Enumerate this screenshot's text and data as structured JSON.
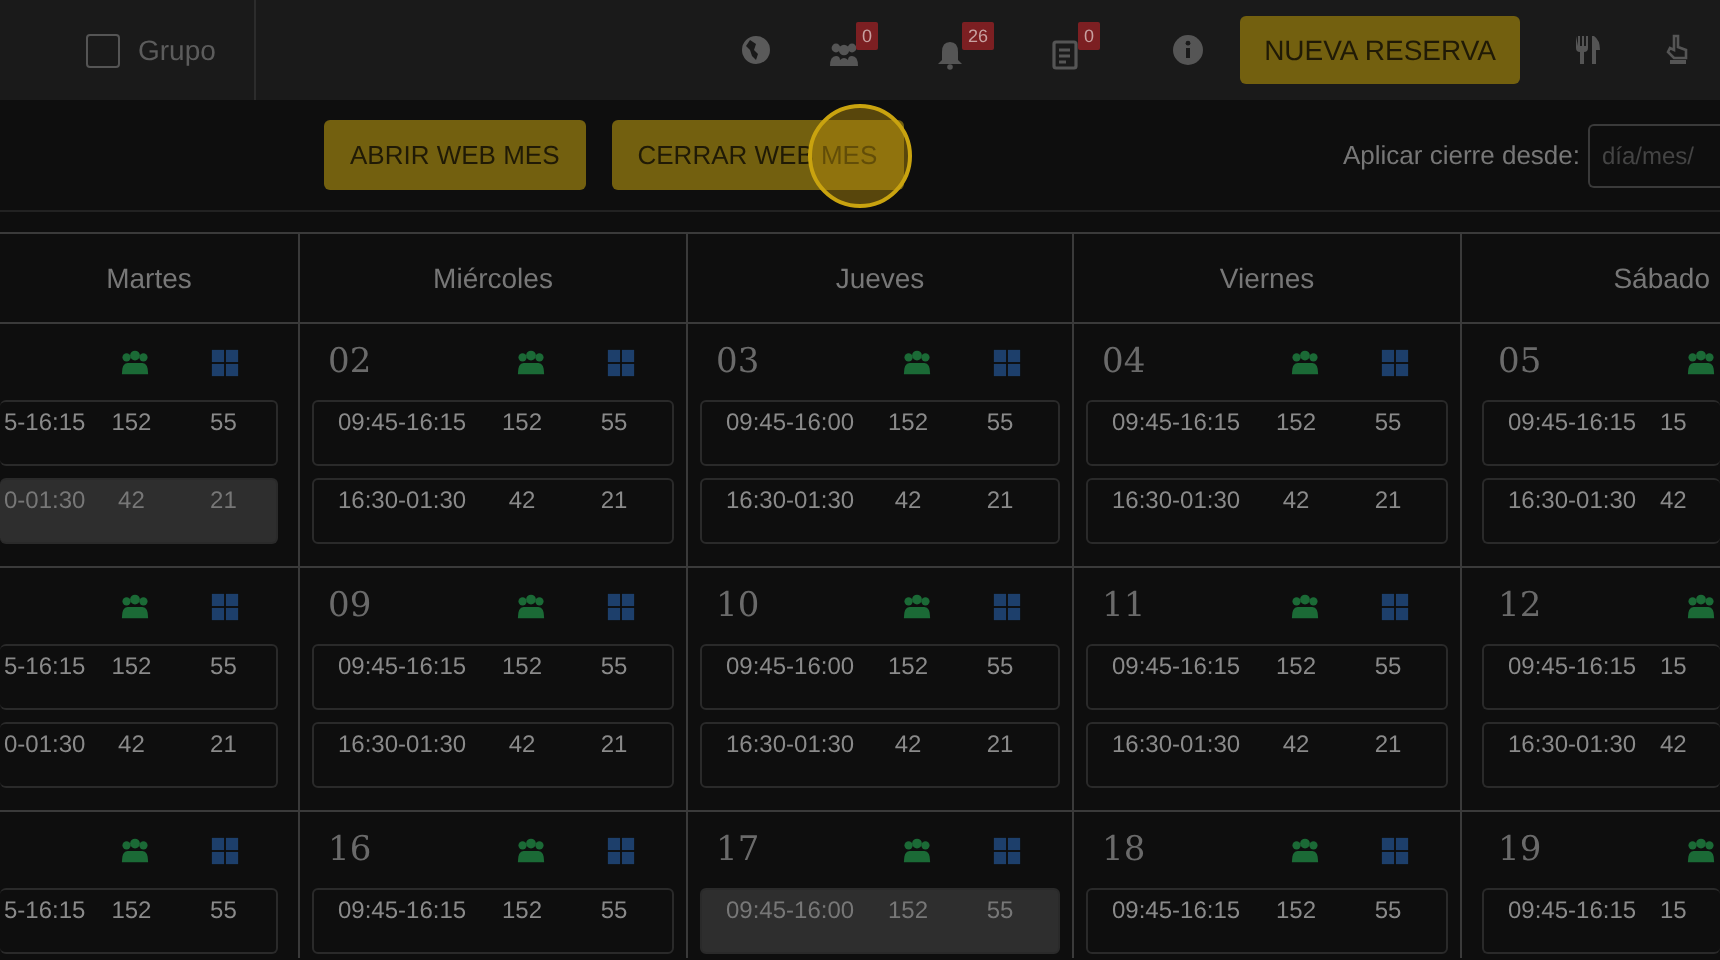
{
  "topbar": {
    "group_checkbox": {
      "label": "Grupo",
      "checked": false
    },
    "badges": [
      {
        "kind": "people",
        "count": "0"
      },
      {
        "kind": "bell",
        "count": "26"
      },
      {
        "kind": "clipboard",
        "count": "0"
      }
    ],
    "new_button": "NUEVA RESERVA"
  },
  "toolbar": {
    "buttons": [
      "ABRIR WEB MES",
      "CERRAR WEB MES"
    ],
    "close_label": "Aplicar cierre desde:",
    "date_field": {
      "placeholder": "día/mes/"
    }
  },
  "calendar": {
    "days": [
      "Martes",
      "Miércoles",
      "Jueves",
      "Viernes",
      "Sábado"
    ],
    "weeks": [
      {
        "cells": [
          {
            "slots": [
              {
                "time": "5-16:15",
                "counts": [
                  "152",
                  "55"
                ],
                "selected": false
              },
              {
                "time": "0-01:30",
                "counts": [
                  "42",
                  "21"
                ],
                "selected": true
              }
            ]
          },
          {
            "date": "02",
            "slots": [
              {
                "time": "09:45-16:15",
                "counts": [
                  "152",
                  "55"
                ],
                "selected": false
              },
              {
                "time": "16:30-01:30",
                "counts": [
                  "42",
                  "21"
                ],
                "selected": false
              }
            ]
          },
          {
            "date": "03",
            "slots": [
              {
                "time": "09:45-16:00",
                "counts": [
                  "152",
                  "55"
                ],
                "selected": false
              },
              {
                "time": "16:30-01:30",
                "counts": [
                  "42",
                  "21"
                ],
                "selected": false
              }
            ]
          },
          {
            "date": "04",
            "slots": [
              {
                "time": "09:45-16:15",
                "counts": [
                  "152",
                  "55"
                ],
                "selected": false
              },
              {
                "time": "16:30-01:30",
                "counts": [
                  "42",
                  "21"
                ],
                "selected": false
              }
            ]
          },
          {
            "date": "05",
            "slots": [
              {
                "time": "09:45-16:15",
                "counts": [
                  "15"
                ],
                "selected": false
              },
              {
                "time": "16:30-01:30",
                "counts": [
                  "42"
                ],
                "selected": false
              }
            ]
          }
        ]
      },
      {
        "cells": [
          {
            "slots": [
              {
                "time": "5-16:15",
                "counts": [
                  "152",
                  "55"
                ],
                "selected": false
              },
              {
                "time": "0-01:30",
                "counts": [
                  "42",
                  "21"
                ],
                "selected": false
              }
            ]
          },
          {
            "date": "09",
            "slots": [
              {
                "time": "09:45-16:15",
                "counts": [
                  "152",
                  "55"
                ],
                "selected": false
              },
              {
                "time": "16:30-01:30",
                "counts": [
                  "42",
                  "21"
                ],
                "selected": false
              }
            ]
          },
          {
            "date": "10",
            "slots": [
              {
                "time": "09:45-16:00",
                "counts": [
                  "152",
                  "55"
                ],
                "selected": false
              },
              {
                "time": "16:30-01:30",
                "counts": [
                  "42",
                  "21"
                ],
                "selected": false
              }
            ]
          },
          {
            "date": "11",
            "slots": [
              {
                "time": "09:45-16:15",
                "counts": [
                  "152",
                  "55"
                ],
                "selected": false
              },
              {
                "time": "16:30-01:30",
                "counts": [
                  "42",
                  "21"
                ],
                "selected": false
              }
            ]
          },
          {
            "date": "12",
            "slots": [
              {
                "time": "09:45-16:15",
                "counts": [
                  "15"
                ],
                "selected": false
              },
              {
                "time": "16:30-01:30",
                "counts": [
                  "42"
                ],
                "selected": false
              }
            ]
          }
        ]
      },
      {
        "cells": [
          {
            "slots": [
              {
                "time": "5-16:15",
                "counts": [
                  "152",
                  "55"
                ],
                "selected": false
              }
            ]
          },
          {
            "date": "16",
            "slots": [
              {
                "time": "09:45-16:15",
                "counts": [
                  "152",
                  "55"
                ],
                "selected": false
              }
            ]
          },
          {
            "date": "17",
            "slots": [
              {
                "time": "09:45-16:00",
                "counts": [
                  "152",
                  "55"
                ],
                "selected": true
              }
            ]
          },
          {
            "date": "18",
            "slots": [
              {
                "time": "09:45-16:15",
                "counts": [
                  "152",
                  "55"
                ],
                "selected": false
              }
            ]
          },
          {
            "date": "19",
            "slots": [
              {
                "time": "09:45-16:15",
                "counts": [
                  "15"
                ],
                "selected": false
              }
            ]
          }
        ]
      }
    ]
  }
}
